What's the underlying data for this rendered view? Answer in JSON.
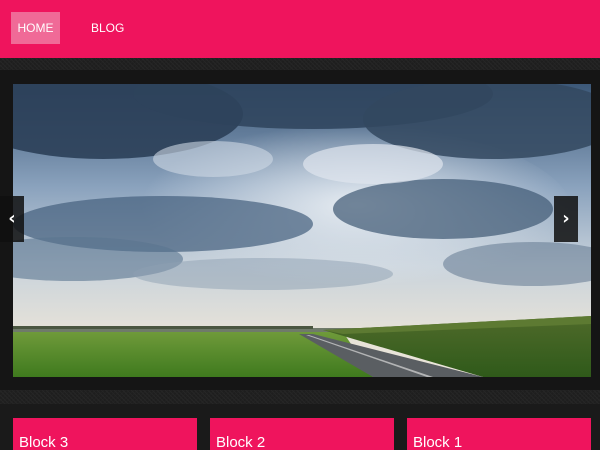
{
  "nav": {
    "items": [
      {
        "label": "HOME",
        "active": true
      },
      {
        "label": "BLOG",
        "active": false
      }
    ]
  },
  "slider": {
    "image": "landscape-photo-cloudy-sky-road-field",
    "prev_icon": "chevron-left-icon",
    "next_icon": "chevron-right-icon",
    "prev_label": "‹",
    "next_label": "›"
  },
  "blocks": [
    {
      "title": "Block 3"
    },
    {
      "title": "Block 2"
    },
    {
      "title": "Block 1"
    }
  ],
  "colors": {
    "accent": "#ef145d",
    "nav_active": "#f06a97",
    "background": "#1a1a1a"
  }
}
